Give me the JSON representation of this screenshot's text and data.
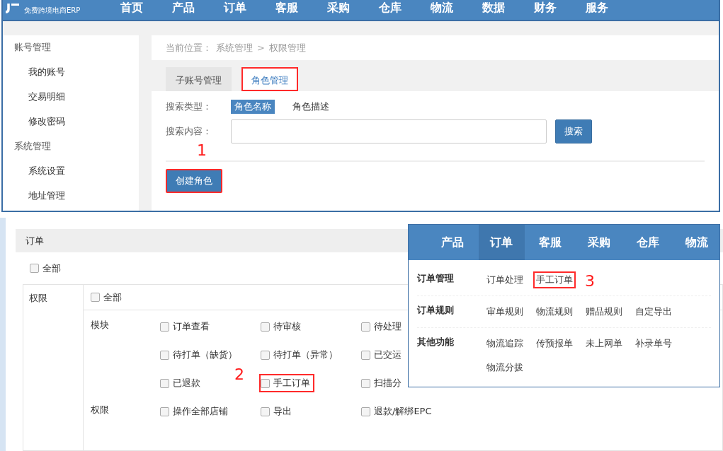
{
  "top_window": {
    "logo_tagline": "免费跨境电商ERP",
    "nav": [
      {
        "label": "首页"
      },
      {
        "label": "产品"
      },
      {
        "label": "订单"
      },
      {
        "label": "客服"
      },
      {
        "label": "采购"
      },
      {
        "label": "仓库"
      },
      {
        "label": "物流"
      },
      {
        "label": "数据"
      },
      {
        "label": "财务"
      },
      {
        "label": "服务"
      }
    ],
    "sidebar": [
      {
        "label": "账号管理",
        "children": [
          {
            "label": "我的账号"
          },
          {
            "label": "交易明细"
          },
          {
            "label": "修改密码"
          }
        ]
      },
      {
        "label": "系统管理",
        "children": [
          {
            "label": "系统设置"
          },
          {
            "label": "地址管理"
          }
        ]
      }
    ],
    "breadcrumb": {
      "label": "当前位置：",
      "path": [
        "系统管理",
        "权限管理"
      ],
      "separator": ">"
    },
    "tabs": [
      {
        "label": "子账号管理",
        "selected": false,
        "highlighted": false
      },
      {
        "label": "角色管理",
        "selected": true,
        "highlighted": true
      }
    ],
    "search_type_label": "搜索类型：",
    "search_types": [
      {
        "label": "角色名称",
        "selected": true
      },
      {
        "label": "角色描述",
        "selected": false
      }
    ],
    "search_label": "搜索内容：",
    "search_button": "搜索",
    "create_button": {
      "label": "创建角色",
      "highlighted": true
    }
  },
  "permissions_panel": {
    "title": "订单",
    "all": {
      "label": "全部",
      "checked": false
    },
    "table": {
      "header": "权限",
      "all": {
        "label": "全部",
        "checked": false
      },
      "rows": [
        {
          "label": "模块",
          "items": [
            {
              "label": "订单查看",
              "checked": false,
              "highlighted": false
            },
            {
              "label": "待审核",
              "checked": false,
              "highlighted": false
            },
            {
              "label": "待处理",
              "checked": false,
              "highlighted": false
            },
            {
              "label": "待打单（缺货）",
              "checked": false,
              "highlighted": false
            },
            {
              "label": "待打单（异常）",
              "checked": false,
              "highlighted": false
            },
            {
              "label": "已交运",
              "checked": false,
              "highlighted": false
            },
            {
              "label": "已退款",
              "checked": false,
              "highlighted": false
            },
            {
              "label": "手工订单",
              "checked": false,
              "highlighted": true
            },
            {
              "label": "扫描分",
              "checked": false,
              "highlighted": false
            }
          ]
        },
        {
          "label": "权限",
          "items": [
            {
              "label": "操作全部店铺",
              "checked": false,
              "highlighted": false
            },
            {
              "label": "导出",
              "checked": false,
              "highlighted": false
            },
            {
              "label": "退款/解绑EPC",
              "checked": false,
              "highlighted": false
            }
          ]
        }
      ]
    }
  },
  "menu_window": {
    "nav": [
      {
        "label": "产品",
        "selected": false
      },
      {
        "label": "订单",
        "selected": true
      },
      {
        "label": "客服",
        "selected": false
      },
      {
        "label": "采购",
        "selected": false
      },
      {
        "label": "仓库",
        "selected": false
      },
      {
        "label": "物流",
        "selected": false
      }
    ],
    "groups": [
      {
        "title": "订单管理",
        "links": [
          {
            "label": "订单处理",
            "highlighted": false
          },
          {
            "label": "手工订单",
            "highlighted": true
          }
        ]
      },
      {
        "title": "订单规则",
        "links": [
          {
            "label": "审单规则",
            "highlighted": false
          },
          {
            "label": "物流规则",
            "highlighted": false
          },
          {
            "label": "赠品规则",
            "highlighted": false
          },
          {
            "label": "自定导出",
            "highlighted": false
          }
        ]
      },
      {
        "title": "其他功能",
        "links": [
          {
            "label": "物流追踪",
            "highlighted": false
          },
          {
            "label": "传预报单",
            "highlighted": false
          },
          {
            "label": "未上网单",
            "highlighted": false
          },
          {
            "label": "补录单号",
            "highlighted": false
          },
          {
            "label": "物流分拨",
            "highlighted": false
          }
        ]
      }
    ]
  },
  "annotations": [
    {
      "number": "1"
    },
    {
      "number": "2"
    },
    {
      "number": "3"
    }
  ]
}
